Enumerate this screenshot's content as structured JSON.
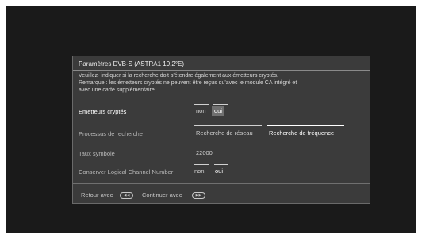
{
  "dialog": {
    "title": "Paramètres DVB-S (ASTRA1 19,2°E)",
    "description": [
      "Veuillez- indiquer si la recherche doit s'étendre également  aux émetteurs cryptés.",
      "Remarque : les émetteurs cryptés ne peuvent être reçus qu'avec le module CA intégré et",
      "avec une carte supplémentaire."
    ]
  },
  "rows": {
    "encrypted": {
      "label": "Emetteurs cryptés",
      "option_no": "non",
      "option_yes": "oui",
      "selected": "oui"
    },
    "search": {
      "label": "Processus de recherche",
      "option_network": "Recherche de réseau",
      "option_frequency": "Recherche de fréquence",
      "selected": "Recherche de fréquence"
    },
    "symbol_rate": {
      "label": "Taux symbole",
      "value": "22000"
    },
    "lcn": {
      "label": "Conserver Logical Channel Number",
      "option_no": "non",
      "option_yes": "oui",
      "selected": "oui"
    }
  },
  "footer": {
    "back_label": "Retour avec",
    "back_icon": "rewind-button-icon",
    "continue_label": "Continuer avec",
    "continue_icon": "forward-button-icon"
  },
  "colors": {
    "screen": "#1a1a1a",
    "panel": "#3b3b3b",
    "highlight": "#707070"
  }
}
